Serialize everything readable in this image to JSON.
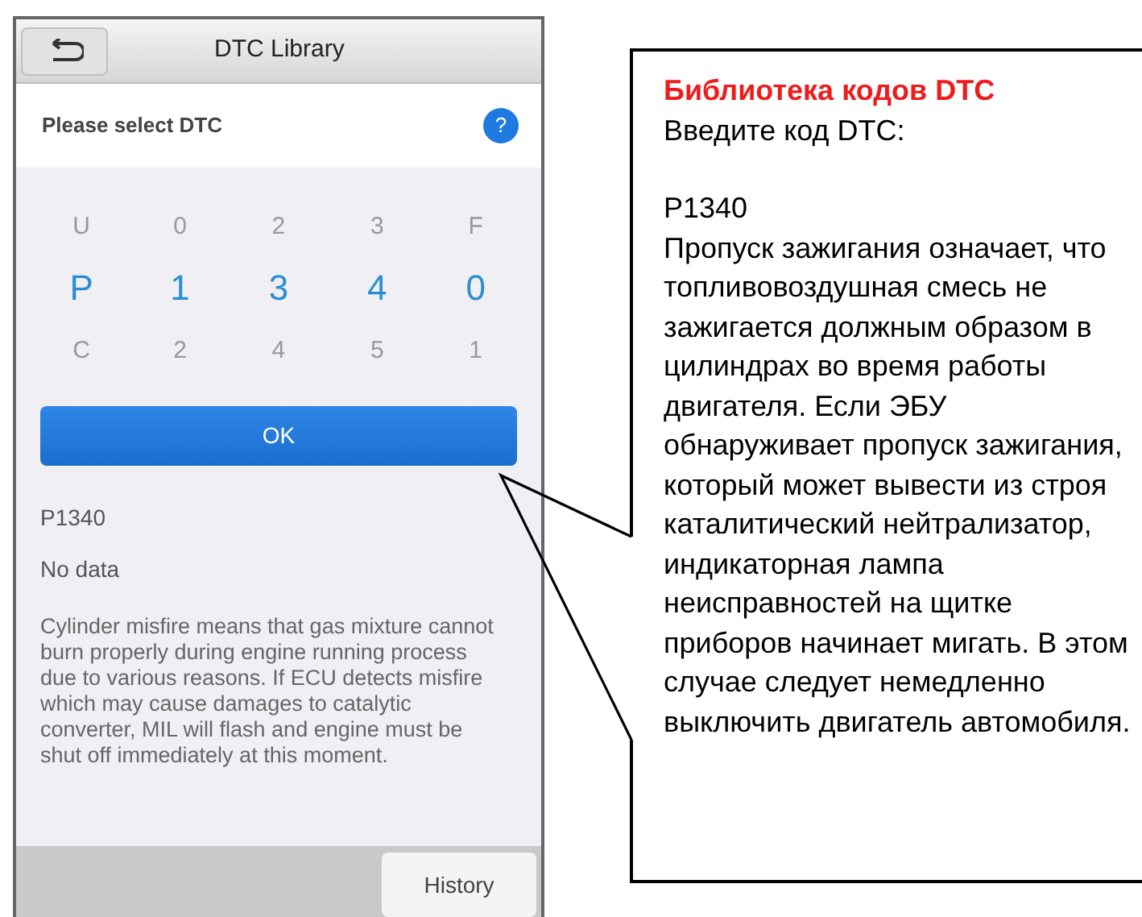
{
  "header": {
    "title": "DTC Library"
  },
  "prompt": {
    "text": "Please select DTC",
    "help": "?"
  },
  "picker": {
    "columns": [
      {
        "items": [
          {
            "label": "U",
            "selected": false
          },
          {
            "label": "P",
            "selected": true
          },
          {
            "label": "C",
            "selected": false
          }
        ]
      },
      {
        "items": [
          {
            "label": "0",
            "selected": false
          },
          {
            "label": "1",
            "selected": true
          },
          {
            "label": "2",
            "selected": false
          }
        ]
      },
      {
        "items": [
          {
            "label": "2",
            "selected": false
          },
          {
            "label": "3",
            "selected": true
          },
          {
            "label": "4",
            "selected": false
          }
        ]
      },
      {
        "items": [
          {
            "label": "3",
            "selected": false
          },
          {
            "label": "4",
            "selected": true
          },
          {
            "label": "5",
            "selected": false
          }
        ]
      },
      {
        "items": [
          {
            "label": "F",
            "selected": false
          },
          {
            "label": "0",
            "selected": true
          },
          {
            "label": "1",
            "selected": false
          }
        ]
      }
    ]
  },
  "ok_button": "OK",
  "result": {
    "code": "P1340",
    "status": "No data",
    "description": "Cylinder misfire means that gas mixture cannot burn properly during engine running process due to various reasons. If ECU detects misfire which may cause damages to catalytic converter, MIL will flash and engine must be shut off immediately at this moment."
  },
  "footer": {
    "button": "History"
  },
  "callout": {
    "title": "Библиотека кодов DTC",
    "lines": [
      "Введите код DTC:",
      "P1340",
      "Пропуск зажигания означает, что топливовоздушная смесь не зажигается должным образом в цилиндрах во время работы двигателя. Если ЭБУ обнаруживает пропуск зажигания, который может вывести из строя каталитический нейтрализатор, индикаторная лампа неисправностей на щитке приборов начинает мигать. В этом случае следует немедленно выключить двигатель автомобиля."
    ]
  }
}
